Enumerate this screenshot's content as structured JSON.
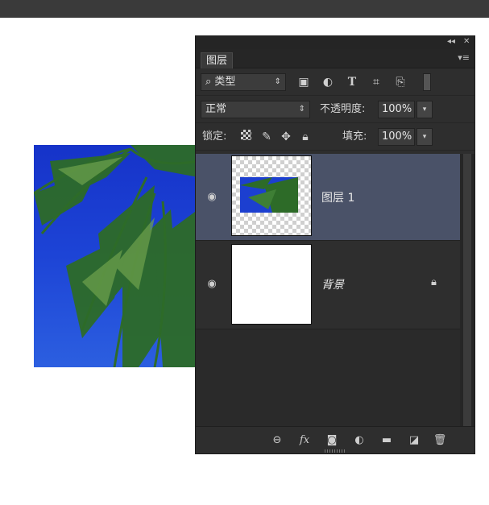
{
  "panel": {
    "tab_label": "图层",
    "filter": {
      "label": "类型",
      "icons": [
        "image-filter-icon",
        "adjustment-filter-icon",
        "type-filter-icon",
        "shape-filter-icon",
        "smart-object-filter-icon",
        "filter-toggle-icon"
      ]
    },
    "blend_mode": "正常",
    "opacity_label": "不透明度:",
    "opacity_value": "100%",
    "lock_label": "锁定:",
    "fill_label": "填充:",
    "fill_value": "100%"
  },
  "layers": [
    {
      "name": "图层 1",
      "selected": true,
      "visible": true,
      "locked": false
    },
    {
      "name": "背景",
      "selected": false,
      "visible": true,
      "locked": true
    }
  ],
  "footer_icons": [
    "link-icon",
    "fx-icon",
    "mask-icon",
    "adjustment-icon",
    "group-folder-icon",
    "new-layer-icon",
    "trash-icon"
  ],
  "colors": {
    "panel_bg": "#2e2e2e",
    "selected_layer": "#4a5268",
    "sky": "#1d44d6"
  }
}
